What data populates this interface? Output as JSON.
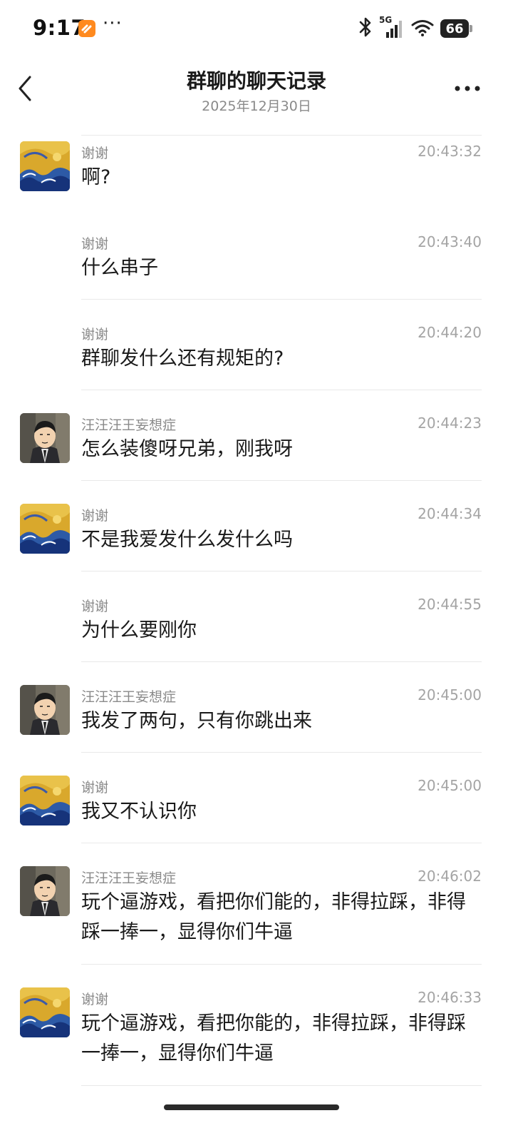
{
  "status_bar": {
    "time": "9:17",
    "more": "···",
    "network": "5G",
    "battery": "66",
    "icons": [
      "app-notification-icon",
      "bluetooth-icon",
      "signal-icon",
      "wifi-icon",
      "battery-icon"
    ]
  },
  "header": {
    "title": "群聊的聊天记录",
    "subtitle": "2025年12月30日",
    "back_icon": "chevron-left-icon",
    "more_icon": "more-horizontal-icon"
  },
  "colors": {
    "text_primary": "#1a1a1a",
    "text_secondary": "#8a8a8a",
    "divider": "#e9e9e9",
    "background": "#ffffff"
  },
  "messages": [
    {
      "sender": "谢谢",
      "time": "20:43:32",
      "text": "啊?",
      "avatar": "starry-wave-avatar"
    },
    {
      "sender": "谢谢",
      "time": "20:43:40",
      "text": "什么串子",
      "avatar": ""
    },
    {
      "sender": "谢谢",
      "time": "20:44:20",
      "text": "群聊发什么还有规矩的?",
      "avatar": ""
    },
    {
      "sender": "汪汪汪王妄想症",
      "time": "20:44:23",
      "text": "怎么装傻呀兄弟，刚我呀",
      "avatar": "cartoon-man-avatar"
    },
    {
      "sender": "谢谢",
      "time": "20:44:34",
      "text": "不是我爱发什么发什么吗",
      "avatar": "starry-wave-avatar"
    },
    {
      "sender": "谢谢",
      "time": "20:44:55",
      "text": "为什么要刚你",
      "avatar": ""
    },
    {
      "sender": "汪汪汪王妄想症",
      "time": "20:45:00",
      "text": "我发了两句，只有你跳出来",
      "avatar": "cartoon-man-avatar"
    },
    {
      "sender": "谢谢",
      "time": "20:45:00",
      "text": "我又不认识你",
      "avatar": "starry-wave-avatar"
    },
    {
      "sender": "汪汪汪王妄想症",
      "time": "20:46:02",
      "text": "玩个逼游戏，看把你们能的，非得拉踩，非得踩一捧一，显得你们牛逼",
      "avatar": "cartoon-man-avatar"
    },
    {
      "sender": "谢谢",
      "time": "20:46:33",
      "text": "玩个逼游戏，看把你能的，非得拉踩，非得踩一捧一，显得你们牛逼",
      "avatar": "starry-wave-avatar"
    }
  ]
}
